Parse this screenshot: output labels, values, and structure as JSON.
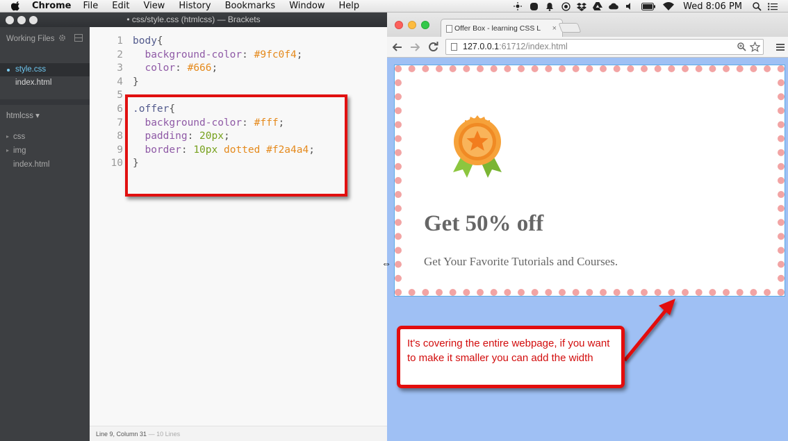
{
  "menubar": {
    "app_name": "Chrome",
    "menus": [
      "File",
      "Edit",
      "View",
      "History",
      "Bookmarks",
      "Window",
      "Help"
    ],
    "clock": "Wed 8:06 PM",
    "tray_icons": [
      "brightness-icon",
      "skype-icon",
      "notification-icon",
      "record-icon",
      "dropbox-icon",
      "google-drive-icon",
      "creative-cloud-icon",
      "volume-icon",
      "battery-icon",
      "wifi-icon",
      "search-icon",
      "list-icon"
    ]
  },
  "brackets": {
    "title": "• css/style.css (htmlcss) — Brackets",
    "sidebar": {
      "working_files_label": "Working Files",
      "working_files": [
        {
          "name": "style.css",
          "active": true
        },
        {
          "name": "index.html",
          "active": false
        }
      ],
      "project_name": "htmlcss ▾",
      "tree": [
        "css",
        "img",
        "index.html"
      ]
    },
    "code": [
      {
        "n": "1",
        "tokens": [
          {
            "t": "body",
            "c": "sel"
          },
          {
            "t": "{",
            "c": "punc"
          }
        ]
      },
      {
        "n": "2",
        "tokens": [
          {
            "t": "  ",
            "c": "punc"
          },
          {
            "t": "background-color",
            "c": "prop"
          },
          {
            "t": ": ",
            "c": "punc"
          },
          {
            "t": "#9fc0f4",
            "c": "val"
          },
          {
            "t": ";",
            "c": "punc"
          }
        ]
      },
      {
        "n": "3",
        "tokens": [
          {
            "t": "  ",
            "c": "punc"
          },
          {
            "t": "color",
            "c": "prop"
          },
          {
            "t": ": ",
            "c": "punc"
          },
          {
            "t": "#666",
            "c": "val"
          },
          {
            "t": ";",
            "c": "punc"
          }
        ]
      },
      {
        "n": "4",
        "tokens": [
          {
            "t": "}",
            "c": "punc"
          }
        ]
      },
      {
        "n": "5",
        "tokens": []
      },
      {
        "n": "6",
        "tokens": [
          {
            "t": ".offer",
            "c": "sel"
          },
          {
            "t": "{",
            "c": "punc"
          }
        ]
      },
      {
        "n": "7",
        "tokens": [
          {
            "t": "  ",
            "c": "punc"
          },
          {
            "t": "background-color",
            "c": "prop"
          },
          {
            "t": ": ",
            "c": "punc"
          },
          {
            "t": "#fff",
            "c": "val"
          },
          {
            "t": ";",
            "c": "punc"
          }
        ]
      },
      {
        "n": "8",
        "tokens": [
          {
            "t": "  ",
            "c": "punc"
          },
          {
            "t": "padding",
            "c": "prop"
          },
          {
            "t": ": ",
            "c": "punc"
          },
          {
            "t": "20px",
            "c": "num"
          },
          {
            "t": ";",
            "c": "punc"
          }
        ]
      },
      {
        "n": "9",
        "tokens": [
          {
            "t": "  ",
            "c": "punc"
          },
          {
            "t": "border",
            "c": "prop"
          },
          {
            "t": ": ",
            "c": "punc"
          },
          {
            "t": "10px",
            "c": "num"
          },
          {
            "t": " ",
            "c": "punc"
          },
          {
            "t": "dotted",
            "c": "val"
          },
          {
            "t": " ",
            "c": "punc"
          },
          {
            "t": "#f2a4a4",
            "c": "val"
          },
          {
            "t": ";",
            "c": "punc"
          }
        ]
      },
      {
        "n": "10",
        "tokens": [
          {
            "t": "}",
            "c": "punc"
          }
        ]
      }
    ],
    "status": {
      "cursor": "Line 9, Column 31",
      "lines": "— 10 Lines"
    }
  },
  "chrome": {
    "tab_title": "Offer Box - learning CSS L",
    "tab_close": "×",
    "url_host": "127.0.0.1",
    "url_rest": ":61712/index.html",
    "page": {
      "title": "Get 50% off",
      "subtitle": "Get Your Favorite Tutorials and Courses."
    }
  },
  "annotation": {
    "callout_text": "It's covering the entire webpage, if you want to make it smaller you can add the width"
  },
  "colors": {
    "page_bg": "#9fc0f4",
    "offer_border": "#f2a4a4",
    "annotation_red": "#e30d0d",
    "badge_orange": "#f39a36",
    "badge_ribbon": "#8cc63f"
  }
}
